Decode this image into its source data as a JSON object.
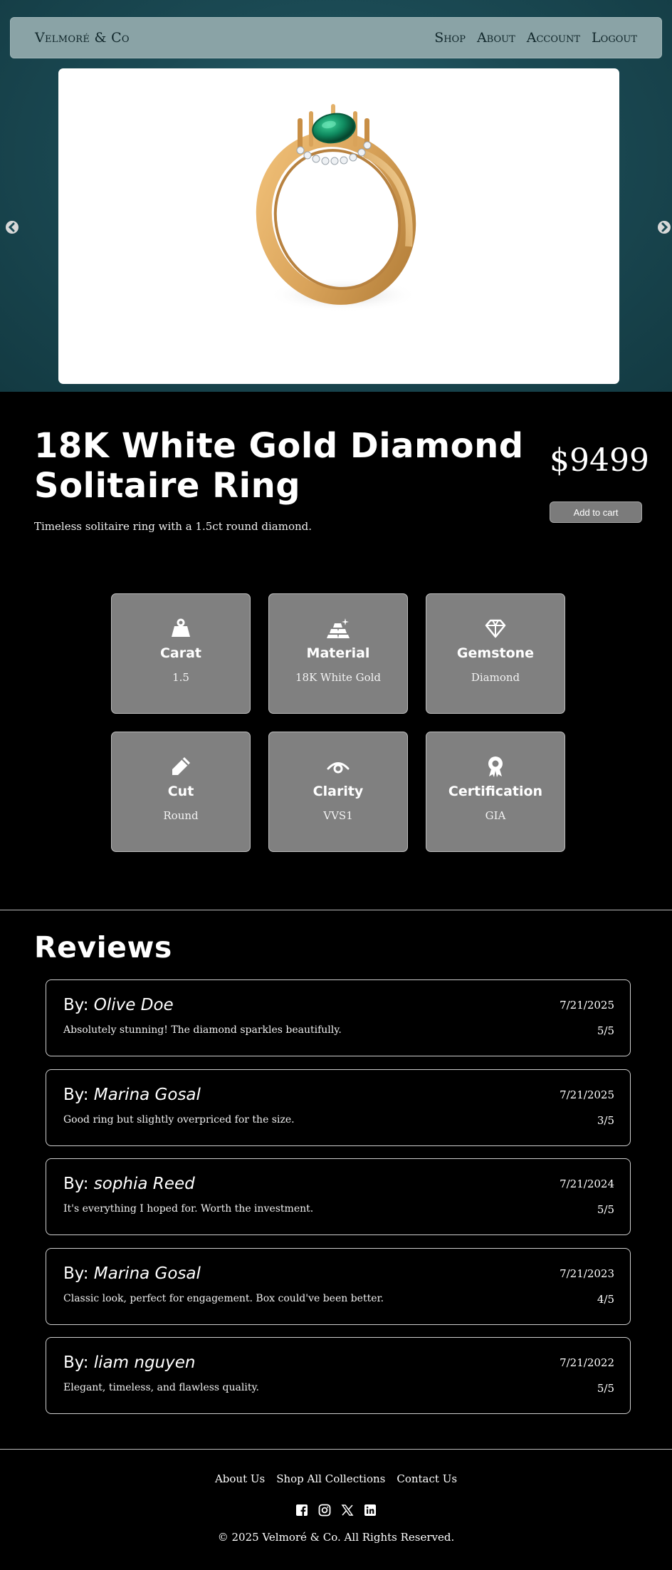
{
  "header": {
    "brand": "Velmoré & Co",
    "nav": [
      "Shop",
      "About",
      "Account",
      "Logout"
    ]
  },
  "carousel": {
    "image_alt_icon": "gold-ring-emerald-image",
    "prev_icon": "chevron-left-icon",
    "next_icon": "chevron-right-icon"
  },
  "product": {
    "title": "18K White Gold Diamond Solitaire Ring",
    "price": "$9499",
    "add_to_cart": "Add to cart",
    "description": "Timeless solitaire ring with a 1.5ct round diamond."
  },
  "specs": [
    {
      "label": "Carat",
      "value": "1.5",
      "icon": "weight-icon"
    },
    {
      "label": "Material",
      "value": "18K White Gold",
      "icon": "gold-bars-icon"
    },
    {
      "label": "Gemstone",
      "value": "Diamond",
      "icon": "gem-icon"
    },
    {
      "label": "Cut",
      "value": "Round",
      "icon": "pen-icon"
    },
    {
      "label": "Clarity",
      "value": "VVS1",
      "icon": "eye-icon"
    },
    {
      "label": "Certification",
      "value": "GIA",
      "icon": "award-icon"
    }
  ],
  "reviews": {
    "heading": "Reviews",
    "by_prefix": "By: ",
    "items": [
      {
        "author": "Olive Doe",
        "date": "7/21/2025",
        "text": "Absolutely stunning! The diamond sparkles beautifully.",
        "rating": "5/5"
      },
      {
        "author": "Marina Gosal",
        "date": "7/21/2025",
        "text": "Good ring but slightly overpriced for the size.",
        "rating": "3/5"
      },
      {
        "author": "sophia Reed",
        "date": "7/21/2024",
        "text": "It's everything I hoped for. Worth the investment.",
        "rating": "5/5"
      },
      {
        "author": "Marina Gosal",
        "date": "7/21/2023",
        "text": "Classic look, perfect for engagement. Box could've been better.",
        "rating": "4/5"
      },
      {
        "author": "liam nguyen",
        "date": "7/21/2022",
        "text": "Elegant, timeless, and flawless quality.",
        "rating": "5/5"
      }
    ]
  },
  "footer": {
    "links": [
      "About Us",
      "Shop All Collections",
      "Contact Us"
    ],
    "social": [
      "facebook-icon",
      "instagram-icon",
      "x-icon",
      "linkedin-icon"
    ],
    "copyright": "© 2025 Velmoré & Co. All Rights Reserved."
  },
  "colors": {
    "hero_bg": "#1b4a54",
    "navbar_bg": "#8aa3a6",
    "card_bg": "#808080",
    "button_bg": "#7b7b7b",
    "gold": "#d9a35a",
    "emerald": "#0f8a5f"
  }
}
